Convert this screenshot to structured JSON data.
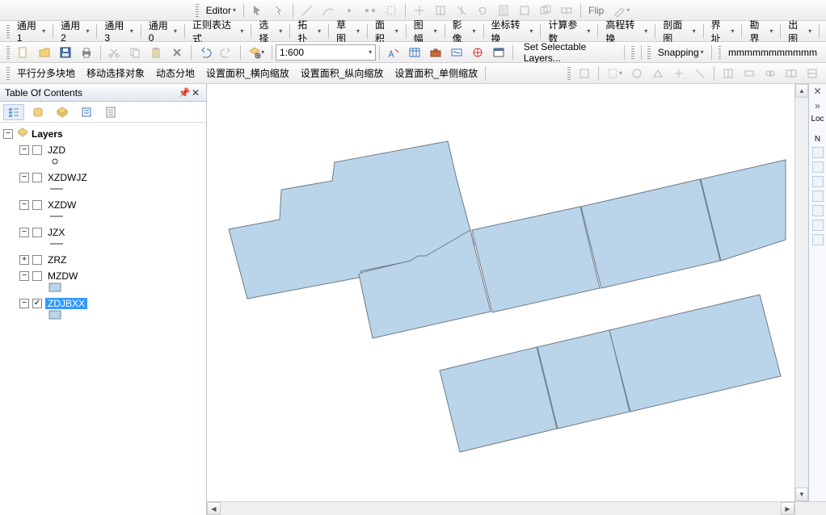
{
  "editor_toolbar": {
    "label": "Editor",
    "flip_label": "Flip"
  },
  "menu_row": {
    "items": [
      "通用1",
      "通用2",
      "通用3",
      "通用0",
      "正则表达式",
      "选择",
      "拓扑",
      "草图",
      "面积",
      "图幅",
      "影像",
      "坐标转换",
      "计算参数",
      "高程转换",
      "剖面图",
      "界址",
      "勘界",
      "出图"
    ]
  },
  "scale": {
    "value": "1:600"
  },
  "selectable_layers_label": "Set Selectable Layers...",
  "snapping_label": "Snapping",
  "mm_label": "mmmmmmmmmmm",
  "cmd_row": {
    "items": [
      "平行分多块地",
      "移动选择对象",
      "动态分地",
      "设置面积_横向缩放",
      "设置面积_纵向缩放",
      "设置面积_单侧缩放"
    ]
  },
  "toc": {
    "title": "Table Of Contents",
    "root": "Layers",
    "layers": [
      {
        "name": "JZD",
        "checked": false,
        "symbol": "circle"
      },
      {
        "name": "XZDWJZ",
        "checked": false,
        "symbol": "line"
      },
      {
        "name": "XZDW",
        "checked": false,
        "symbol": "line"
      },
      {
        "name": "JZX",
        "checked": false,
        "symbol": "line"
      },
      {
        "name": "ZRZ",
        "checked": false,
        "symbol": "none",
        "collapsed": true
      },
      {
        "name": "MZDW",
        "checked": false,
        "symbol": "box"
      },
      {
        "name": "ZDJBXX",
        "checked": true,
        "symbol": "box",
        "selected": true
      }
    ]
  },
  "right_label": "Loc",
  "right_label2": "N",
  "colors": {
    "polygon_fill": "#bad5ea",
    "polygon_stroke": "#6f7b86",
    "selection": "#3399ff"
  },
  "map": {
    "polygons": [
      "287,280 350,268 352,231 415,220 418,197 558,171 569,218 591,300 530,315 521,314 513,319 450,332 453,339 310,366",
      "586,281 590,298 611,382 465,415 448,336 453,333 512,319 521,313 531,313",
      "588,281 722,252 746,353 613,383",
      "723,252 870,218 895,319 748,353",
      "871,218 976,194 976,293 896,319",
      "548,455 668,426 693,527 573,556",
      "669,426 758,405 783,506 694,527",
      "758,405 944,361 970,462 784,506"
    ]
  }
}
